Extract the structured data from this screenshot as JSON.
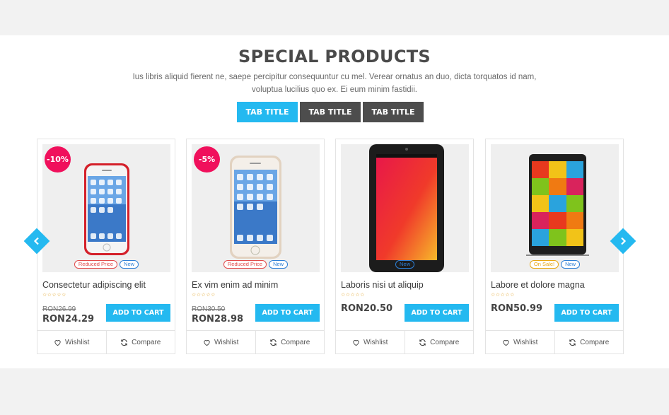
{
  "section": {
    "title": "SPECIAL PRODUCTS",
    "description_line1": "Ius libris aliquid fierent ne, saepe percipitur consequuntur cu mel. Verear ornatus an duo, dicta torquatos id nam,",
    "description_line2": "voluptua lucilius quo ex. Ei eum minim fastidii."
  },
  "tabs": [
    "TAB TITLE",
    "TAB TITLE",
    "TAB TITLE"
  ],
  "active_tab": 0,
  "products": [
    {
      "name": "Consectetur adipiscing elit",
      "discount": "-10%",
      "old_price": "RON26.99",
      "price": "RON24.29",
      "badges": [
        "Reduced Price",
        "New"
      ],
      "rating": "☆☆☆☆☆",
      "add_to_cart": "ADD TO CART",
      "wishlist": "Wishlist",
      "compare": "Compare"
    },
    {
      "name": "Ex vim enim ad minim",
      "discount": "-5%",
      "old_price": "RON30.50",
      "price": "RON28.98",
      "badges": [
        "Reduced Price",
        "New"
      ],
      "rating": "☆☆☆☆☆",
      "add_to_cart": "ADD TO CART",
      "wishlist": "Wishlist",
      "compare": "Compare"
    },
    {
      "name": "Laboris nisi ut aliquip",
      "discount": "",
      "old_price": "",
      "price": "RON20.50",
      "badges": [
        "New"
      ],
      "rating": "☆☆☆☆☆",
      "add_to_cart": "ADD TO CART",
      "wishlist": "Wishlist",
      "compare": "Compare"
    },
    {
      "name": "Labore et dolore magna",
      "discount": "",
      "old_price": "",
      "price": "RON50.99",
      "badges": [
        "On Sale!",
        "New"
      ],
      "rating": "☆☆☆☆☆",
      "add_to_cart": "ADD TO CART",
      "wishlist": "Wishlist",
      "compare": "Compare"
    }
  ],
  "colors": {
    "accent": "#24b9f0",
    "discount": "#f0105c",
    "tab_inactive": "#4d4d4d"
  },
  "icons": {
    "prev": "chevron-left-icon",
    "next": "chevron-right-icon",
    "wishlist": "heart-icon",
    "compare": "refresh-icon"
  }
}
